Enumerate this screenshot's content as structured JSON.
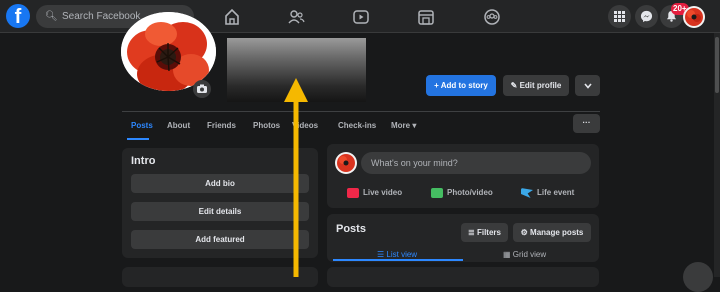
{
  "topbar": {
    "logo": "f",
    "search_placeholder": "Search Facebook",
    "notification_count": "20+"
  },
  "profile": {
    "add_story_label": "+ Add to story",
    "edit_profile_label": "Edit profile",
    "tabs": [
      "Posts",
      "About",
      "Friends",
      "Photos",
      "Videos",
      "Check-ins",
      "More ▾"
    ],
    "more_dots": "···"
  },
  "intro": {
    "title": "Intro",
    "buttons": [
      "Add bio",
      "Edit details",
      "Add featured"
    ]
  },
  "composer": {
    "placeholder": "What's on your mind?",
    "actions": [
      "Live video",
      "Photo/video",
      "Life event"
    ]
  },
  "posts": {
    "title": "Posts",
    "filters_label": "Filters",
    "manage_label": "Manage posts",
    "list_view_label": "List view",
    "grid_view_label": "Grid view"
  },
  "colors": {
    "accent": "#2374e1",
    "arrow": "#f5b800"
  }
}
